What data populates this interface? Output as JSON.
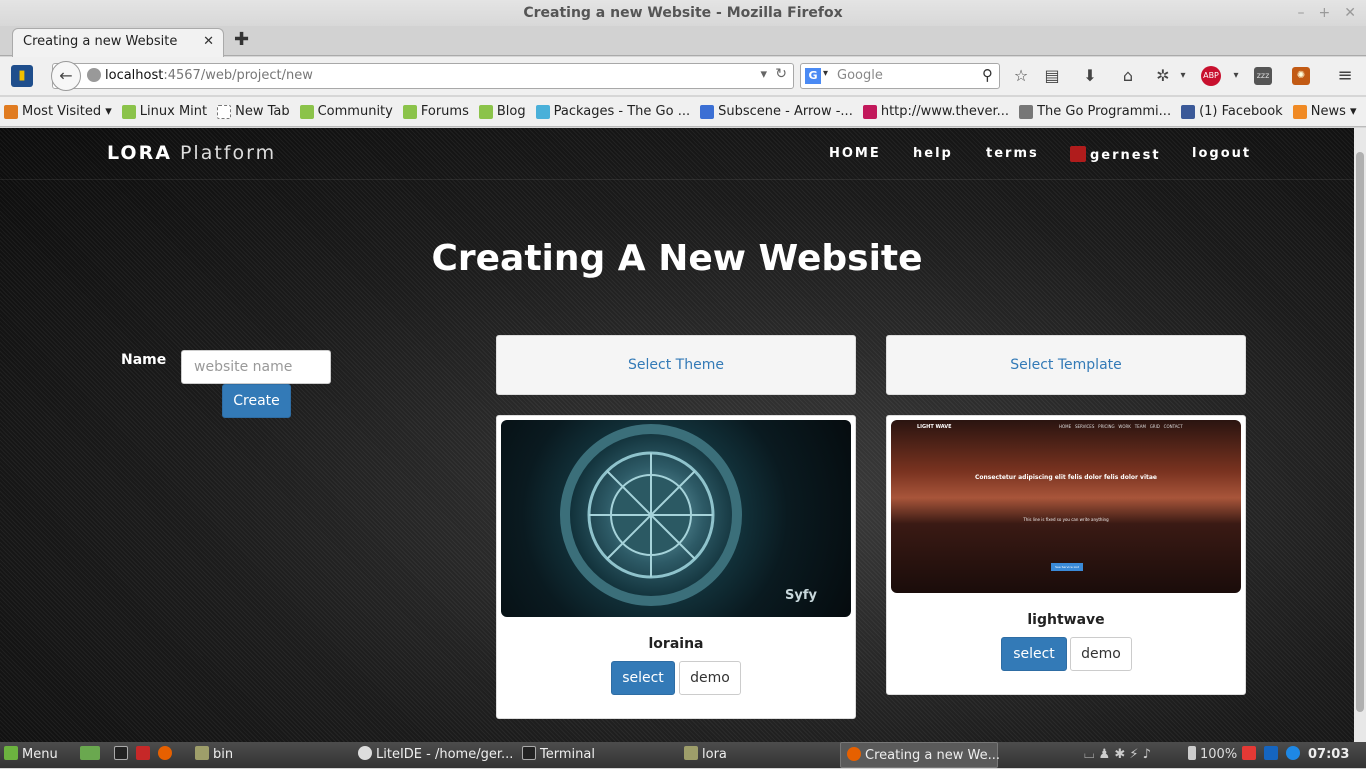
{
  "window": {
    "title": "Creating a new Website - Mozilla Firefox"
  },
  "tab": {
    "label": "Creating a new Website"
  },
  "url": {
    "host": "localhost",
    "rest": ":4567/web/project/new"
  },
  "search": {
    "placeholder": "Google"
  },
  "bookmarks": [
    {
      "label": "Most Visited ▾",
      "color": "#e07b20"
    },
    {
      "label": "Linux Mint",
      "color": "#8bc34a"
    },
    {
      "label": "New Tab",
      "color": "#ffffff"
    },
    {
      "label": "Community",
      "color": "#8bc34a"
    },
    {
      "label": "Forums",
      "color": "#8bc34a"
    },
    {
      "label": "Blog",
      "color": "#8bc34a"
    },
    {
      "label": "Packages - The Go ...",
      "color": "#4ab0d9"
    },
    {
      "label": "Subscene - Arrow -...",
      "color": "#3b6fd4"
    },
    {
      "label": "http://www.thever...",
      "color": "#c2185b"
    },
    {
      "label": "The Go Programmi...",
      "color": "#777777"
    },
    {
      "label": "(1) Facebook",
      "color": "#3b5998"
    },
    {
      "label": "News ▾",
      "color": "#f08a24"
    }
  ],
  "site": {
    "brand_bold": "LORA",
    "brand_light": "Platform",
    "nav": {
      "home": "HOME",
      "help": "help",
      "terms": "terms",
      "user": "gernest",
      "logout": "logout"
    },
    "heading": "Creating A New Website",
    "form": {
      "name_label": "Name",
      "name_placeholder": "website name",
      "create_label": "Create"
    },
    "theme_column_title": "Select Theme",
    "template_column_title": "Select Template",
    "theme_card": {
      "title": "loraina",
      "select_label": "select",
      "demo_label": "demo",
      "watermark": "Syfy"
    },
    "template_card": {
      "title": "lightwave",
      "select_label": "select",
      "demo_label": "demo",
      "preview_brand": "LIGHT WAVE",
      "preview_nav": "HOME   SERVICES   PRICING   WORK   TEAM   GRID   CONTACT",
      "preview_heading": "Consectetur adipiscing elit felis dolor felis dolor vitae",
      "preview_sub": "This line is fixed so you can write anything",
      "preview_button": "See Service List"
    }
  },
  "taskbar": {
    "menu": "Menu",
    "items": [
      "bin",
      "LiteIDE - /home/ger...",
      "Terminal",
      "lora",
      "Creating a new We..."
    ],
    "battery": "100%",
    "clock": "07:03"
  }
}
